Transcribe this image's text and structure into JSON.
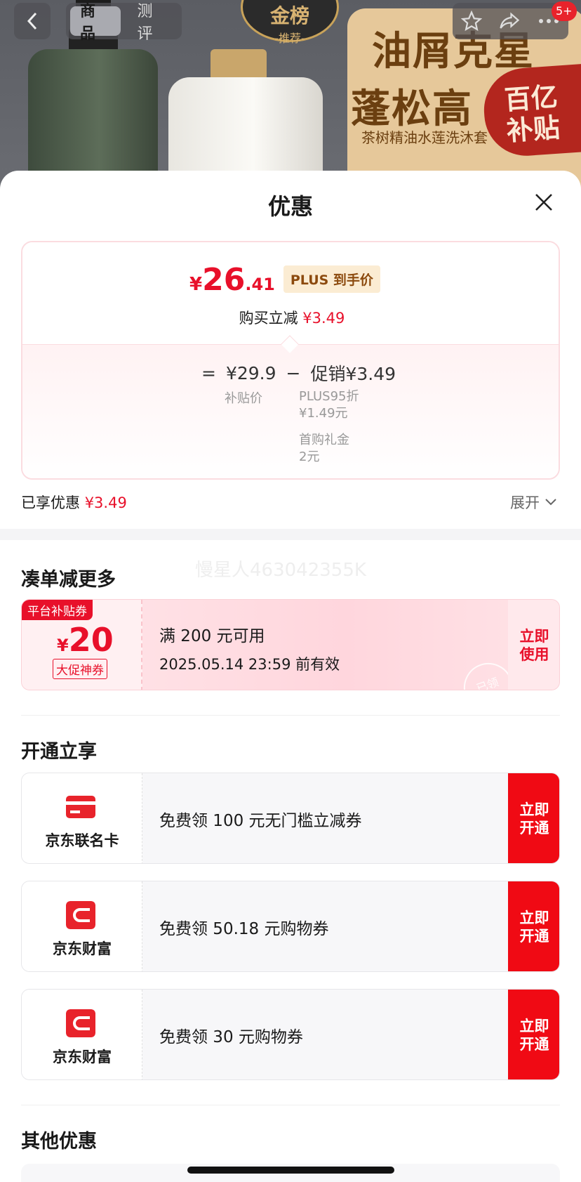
{
  "topbar": {
    "tabs": [
      {
        "label": "商品",
        "active": true
      },
      {
        "label": "测评",
        "active": false
      }
    ],
    "badge_count": "5+"
  },
  "background": {
    "gold_badge_title": "金榜",
    "gold_badge_sub": "-推荐-",
    "promo_line1": "油屑克星",
    "promo_line2": "蓬松高",
    "promo_line3": "茶树精油水莲洗沐套",
    "subsidy_line1": "百亿",
    "subsidy_line2": "补贴"
  },
  "sheet": {
    "title": "优惠",
    "price": {
      "yen": "¥",
      "int": "26",
      "dec": ".41",
      "plus_label": "PLUS 到手价"
    },
    "buy": {
      "label": "购买立减",
      "amount": "¥3.49"
    },
    "calc": {
      "eq": "=",
      "base": "¥29.9",
      "minus": "−",
      "promo": "促销¥3.49",
      "base_label": "补贴价",
      "detail1_l1": "PLUS95折",
      "detail1_l2": "¥1.49元",
      "detail2_l1": "首购礼金",
      "detail2_l2": "2元"
    },
    "enjoyed": {
      "label": "已享优惠",
      "amount": "¥3.49"
    },
    "expand_label": "展开"
  },
  "watermark": "慢星人463042355K",
  "combine": {
    "title": "凑单减更多",
    "coupon": {
      "tag": "平台补贴券",
      "yen": "¥",
      "amount": "20",
      "label": "大促神券",
      "condition": "满 200 元可用",
      "expiry": "2025.05.14 23:59 前有效",
      "button_l1": "立即",
      "button_l2": "使用",
      "stamp": "已领"
    }
  },
  "open": {
    "title": "开通立享",
    "items": [
      {
        "name": "京东联名卡",
        "text": "免费领 100 元无门槛立减券",
        "btn_l1": "立即",
        "btn_l2": "开通"
      },
      {
        "name": "京东财富",
        "text": "免费领 50.18 元购物券",
        "btn_l1": "立即",
        "btn_l2": "开通"
      },
      {
        "name": "京东财富",
        "text": "免费领 30 元购物券",
        "btn_l1": "立即",
        "btn_l2": "开通"
      }
    ]
  },
  "other": {
    "title": "其他优惠"
  },
  "colors": {
    "accent_red": "#e8102a",
    "button_red": "#f00a14",
    "plus_gold": "#8c4a0e"
  },
  "icons": [
    "back-arrow-icon",
    "star-icon",
    "share-icon",
    "more-icon",
    "close-icon",
    "chevron-down-icon",
    "card-icon",
    "wallet-icon"
  ]
}
